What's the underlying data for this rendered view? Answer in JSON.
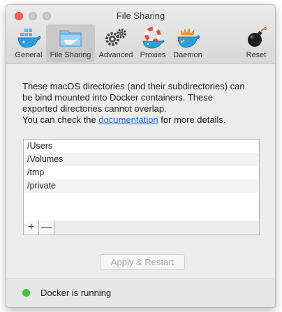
{
  "window": {
    "title": "File Sharing"
  },
  "tabs": [
    {
      "label": "General",
      "icon": "whale-icon"
    },
    {
      "label": "File Sharing",
      "icon": "folder-icon"
    },
    {
      "label": "Advanced",
      "icon": "gears-icon"
    },
    {
      "label": "Proxies",
      "icon": "lifebuoy-whale-icon"
    },
    {
      "label": "Daemon",
      "icon": "daemon-whale-icon"
    },
    {
      "label": "Reset",
      "icon": "bomb-icon"
    }
  ],
  "active_tab": "File Sharing",
  "description": {
    "line1": "These macOS directories (and their subdirectories) can",
    "line2": "be bind mounted into Docker containers. These",
    "line3": "exported directories cannot overlap.",
    "line4_pre": "You can check the ",
    "link": "documentation",
    "line4_post": " for more details."
  },
  "directories": [
    "/Users",
    "/Volumes",
    "/tmp",
    "/private"
  ],
  "list_controls": {
    "add": "+",
    "remove": "—"
  },
  "apply_button": {
    "label": "Apply & Restart",
    "enabled": false
  },
  "status": {
    "text": "Docker is running",
    "color": "#3ac43a"
  },
  "colors": {
    "accent_link": "#1e6fd6",
    "close": "#fc605c"
  }
}
